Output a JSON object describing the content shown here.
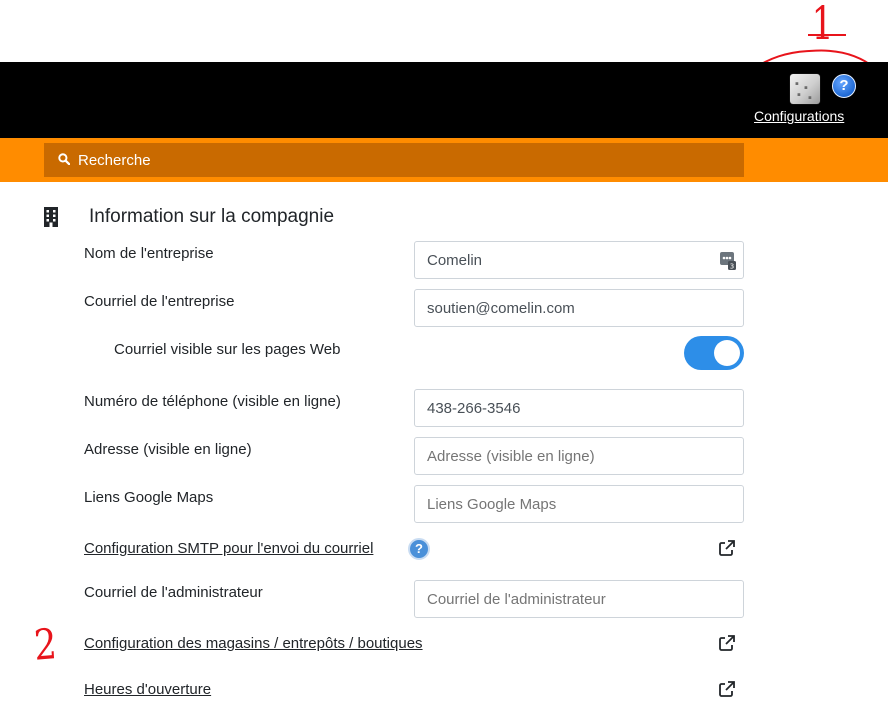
{
  "annotations": {
    "one": "1",
    "two": "2"
  },
  "header": {
    "config_label": "Configurations",
    "help_glyph": "?"
  },
  "search": {
    "label": "Recherche"
  },
  "section": {
    "title": "Information sur la compagnie"
  },
  "fields": [
    {
      "label": "Nom de l'entreprise",
      "value": "Comelin",
      "placeholder": ""
    },
    {
      "label": "Courriel de l'entreprise",
      "value": "soutien@comelin.com",
      "placeholder": ""
    },
    {
      "label": "Numéro de téléphone (visible en ligne)",
      "value": "438-266-3546",
      "placeholder": ""
    },
    {
      "label": "Adresse (visible en ligne)",
      "value": "",
      "placeholder": "Adresse (visible en ligne)"
    },
    {
      "label": "Liens Google Maps",
      "value": "",
      "placeholder": "Liens Google Maps"
    },
    {
      "label": "Courriel de l'administrateur",
      "value": "",
      "placeholder": "Courriel de l'administrateur"
    }
  ],
  "toggle": {
    "label": "Courriel visible sur les pages Web",
    "on": true
  },
  "links": {
    "smtp": "Configuration SMTP pour l'envoi du courriel",
    "stores": "Configuration des magasins / entrepôts / boutiques",
    "hours": "Heures d'ouverture"
  },
  "icons": {
    "config": "settings-panel-icon",
    "help": "help-icon",
    "search": "search-icon",
    "building": "building-icon",
    "external": "external-link-icon",
    "field_badge": "contact-card-icon"
  },
  "colors": {
    "topbar": "#000000",
    "orange": "#ff8c00",
    "search_bg": "#c96a00",
    "toggle_on": "#2d8ee8",
    "annotation": "#e8141b"
  }
}
